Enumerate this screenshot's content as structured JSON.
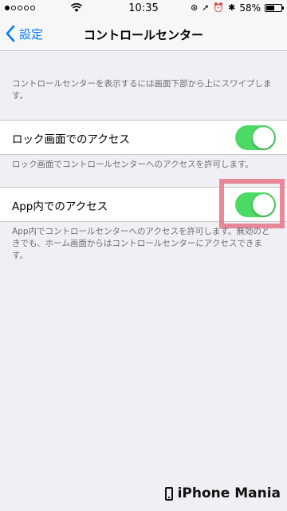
{
  "status_bar": {
    "time": "10:35",
    "battery": "58%",
    "battery_level": 0.58,
    "signal_dots_filled": 1,
    "icons": [
      "wifi-icon",
      "rotation-lock-icon",
      "location-icon",
      "alarm-icon",
      "bluetooth-icon"
    ]
  },
  "nav": {
    "back_label": "設定",
    "title": "コントロールセンター"
  },
  "intro_text": "コントロールセンターを表示するには画面下部から上にスワイプします。",
  "lock_screen": {
    "label": "ロック画面でのアクセス",
    "enabled": true,
    "footer": "ロック画面でコントロールセンターへのアクセスを許可します。"
  },
  "in_app": {
    "label": "App内でのアクセス",
    "enabled": true,
    "footer": "App内でコントロールセンターへのアクセスを許可します。無効のときでも、ホーム画面からはコントロールセンターにアクセスできます。"
  },
  "colors": {
    "accent": "#007aff",
    "switch_on": "#4cd964",
    "highlight": "#e57b8e"
  },
  "watermark": "iPhone Mania"
}
